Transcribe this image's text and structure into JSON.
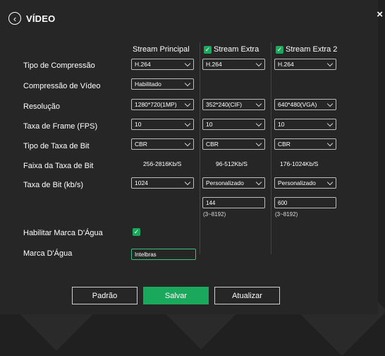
{
  "header": {
    "title": "VÍDEO"
  },
  "columns": {
    "principal": "Stream Principal",
    "extra": "Stream Extra",
    "extra2": "Stream Extra 2"
  },
  "labels": {
    "compression_type": "Tipo de Compressão",
    "video_compression": "Compressão de Vídeo",
    "resolution": "Resolução",
    "frame_rate": "Taxa de Frame (FPS)",
    "bitrate_type": "Tipo de Taxa de Bit",
    "bitrate_range": "Faixa da Taxa de Bit",
    "bitrate": "Taxa de Bit (kb/s)",
    "watermark_enable": "Habilitar Marca D'Água",
    "watermark": "Marca D'Água"
  },
  "principal": {
    "compression": "H.264",
    "video_compression": "Habilitado",
    "resolution": "1280*720(1MP)",
    "fps": "10",
    "bitrate_type": "CBR",
    "bitrate_range": "256-2816Kb/S",
    "bitrate": "1024"
  },
  "extra": {
    "compression": "H.264",
    "resolution": "352*240(CIF)",
    "fps": "10",
    "bitrate_type": "CBR",
    "bitrate_range": "96-512Kb/S",
    "bitrate": "Personalizado",
    "custom_value": "144",
    "custom_hint": "(3~8192)"
  },
  "extra2": {
    "compression": "H.264",
    "resolution": "640*480(VGA)",
    "fps": "10",
    "bitrate_type": "CBR",
    "bitrate_range": "176-1024Kb/S",
    "bitrate": "Personalizado",
    "custom_value": "600",
    "custom_hint": "(3~8192)"
  },
  "watermark": {
    "text": "Intelbras"
  },
  "buttons": {
    "default": "Padrão",
    "save": "Salvar",
    "refresh": "Atualizar"
  },
  "colors": {
    "accent": "#1aa85c",
    "background": "#262626"
  },
  "icons": {
    "back": "circle-chevron-left-icon",
    "close": "close-icon",
    "check": "checkmark-icon"
  }
}
